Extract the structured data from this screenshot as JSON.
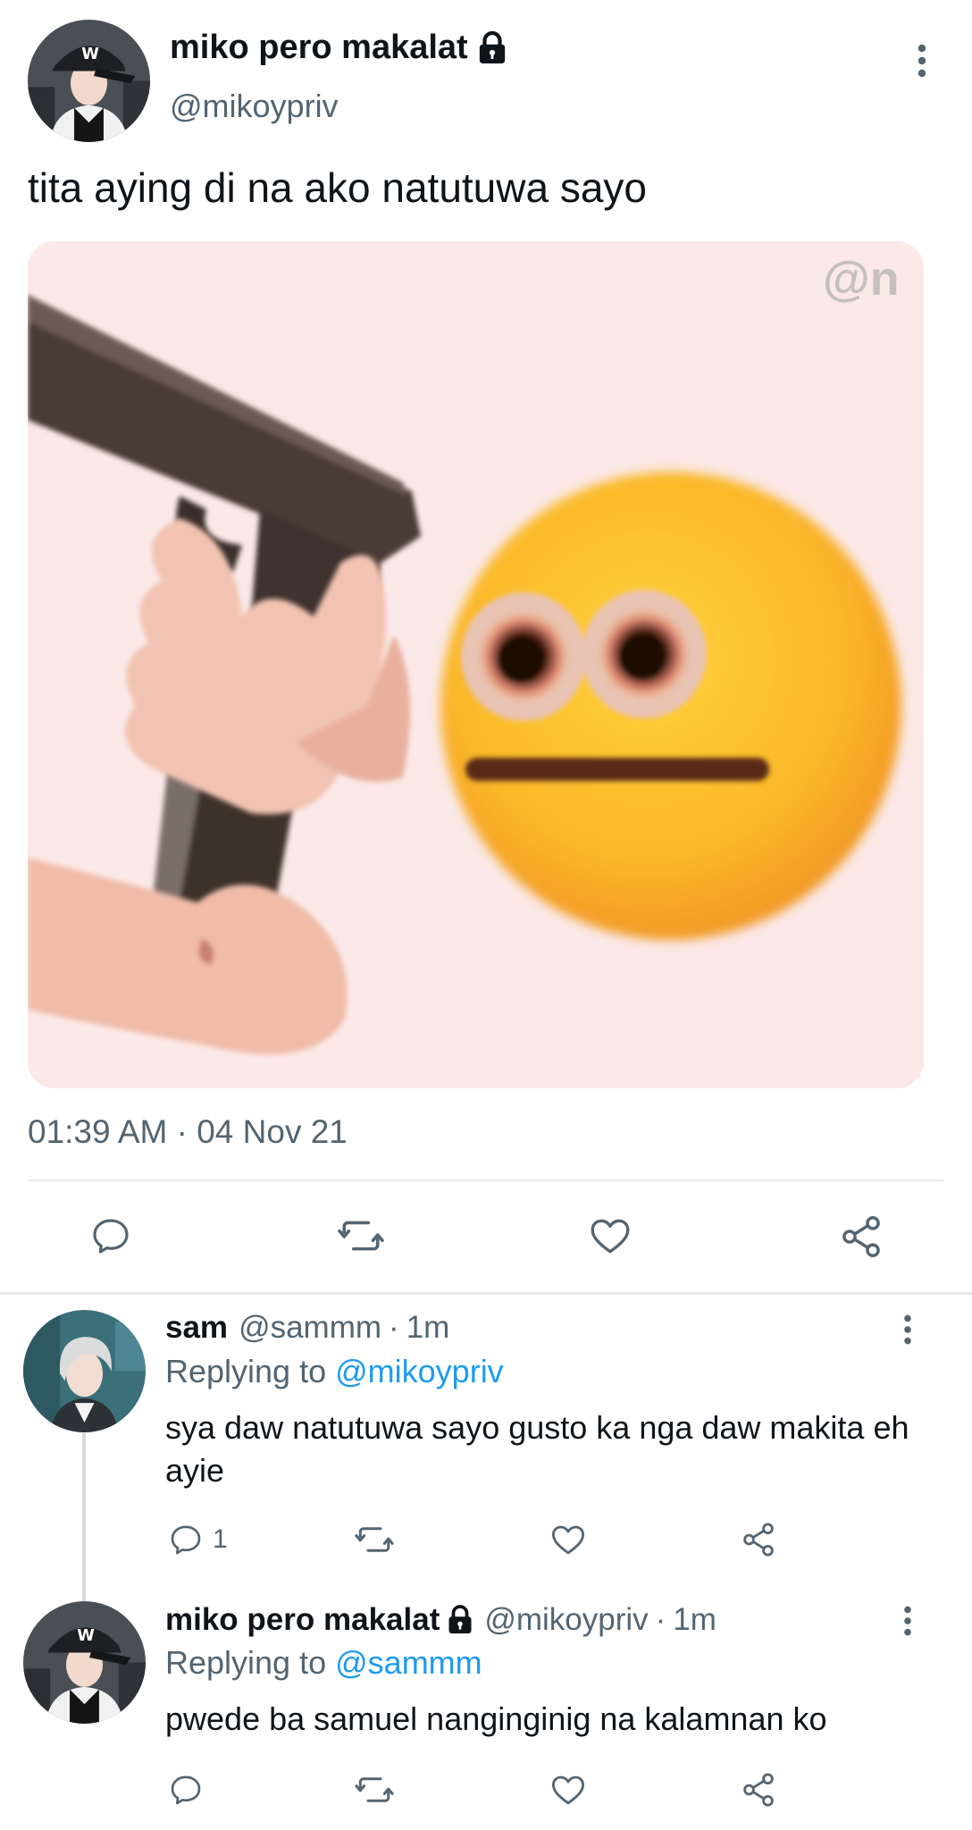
{
  "main_tweet": {
    "display_name": "miko pero makalat",
    "handle": "@mikoypriv",
    "text": "tita aying di na ako natutuwa sayo",
    "media_watermark": "@n",
    "timestamp": "01:39 AM · 04 Nov 21",
    "icons": {
      "avatar": "avatar-person-in-black-cap",
      "lock": "lock-icon",
      "more": "more-vertical-icon",
      "reply": "reply-icon",
      "retweet": "retweet-icon",
      "like": "like-icon",
      "share": "share-icon"
    }
  },
  "replies": [
    {
      "display_name": "sam",
      "handle": "@sammm",
      "dot": "·",
      "time": "1m",
      "replying_prefix": "Replying to",
      "replying_to": "@mikoypriv",
      "text": "sya daw natutuwa sayo gusto ka nga daw makita eh ayie",
      "reply_count": "1"
    },
    {
      "display_name": "miko pero makalat",
      "handle": "@mikoypriv",
      "dot": "·",
      "time": "1m",
      "replying_prefix": "Replying to",
      "replying_to": "@sammm",
      "text": "pwede ba samuel nanginginig na kalamnan ko",
      "reply_count": ""
    }
  ],
  "colors": {
    "text_primary": "#0f1419",
    "text_secondary": "#536471",
    "link": "#1d9bf0",
    "divider": "#e6e9ec"
  }
}
